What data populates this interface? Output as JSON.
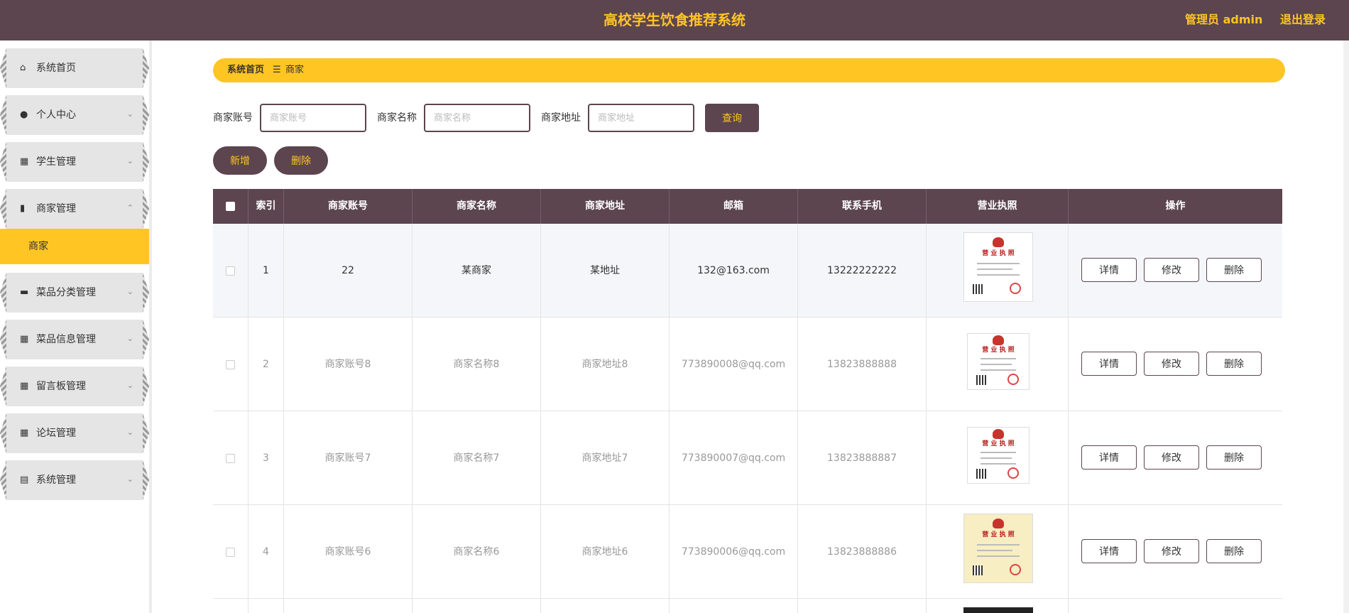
{
  "header": {
    "title": "高校学生饮食推荐系统",
    "admin": "管理员 admin",
    "logout": "退出登录"
  },
  "sidebar": {
    "items": [
      {
        "label": "系统首页",
        "icon": "home-icon",
        "glyph": "⌂",
        "arrow": ""
      },
      {
        "label": "个人中心",
        "icon": "user-icon",
        "glyph": "●",
        "arrow": "⌄"
      },
      {
        "label": "学生管理",
        "icon": "grid-icon",
        "glyph": "▦",
        "arrow": "⌄"
      },
      {
        "label": "商家管理",
        "icon": "bar-chart-icon",
        "glyph": "▮",
        "arrow": "⌃"
      },
      {
        "label": "菜品分类管理",
        "icon": "briefcase-icon",
        "glyph": "▬",
        "arrow": "⌄"
      },
      {
        "label": "菜品信息管理",
        "icon": "grid-icon",
        "glyph": "▦",
        "arrow": "⌄"
      },
      {
        "label": "留言板管理",
        "icon": "grid-icon",
        "glyph": "▦",
        "arrow": "⌄"
      },
      {
        "label": "论坛管理",
        "icon": "grid-icon",
        "glyph": "▦",
        "arrow": "⌄"
      },
      {
        "label": "系统管理",
        "icon": "clipboard-icon",
        "glyph": "▤",
        "arrow": "⌄"
      }
    ],
    "sub_item": "商家"
  },
  "breadcrumb": {
    "home": "系统首页",
    "sep": "☰",
    "current": "商家"
  },
  "search": {
    "account_label": "商家账号",
    "account_placeholder": "商家账号",
    "name_label": "商家名称",
    "name_placeholder": "商家名称",
    "address_label": "商家地址",
    "address_placeholder": "商家地址",
    "query": "查询"
  },
  "actions": {
    "add": "新增",
    "delete": "删除"
  },
  "table": {
    "headers": [
      "索引",
      "商家账号",
      "商家名称",
      "商家地址",
      "邮箱",
      "联系手机",
      "营业执照",
      "操作"
    ],
    "license_title": "营 业 执 照",
    "ops": {
      "detail": "详情",
      "edit": "修改",
      "delete": "删除"
    },
    "rows": [
      {
        "index": "1",
        "account": "22",
        "name": "某商家",
        "address": "某地址",
        "email": "132@163.com",
        "phone": "13222222222"
      },
      {
        "index": "2",
        "account": "商家账号8",
        "name": "商家名称8",
        "address": "商家地址8",
        "email": "773890008@qq.com",
        "phone": "13823888888"
      },
      {
        "index": "3",
        "account": "商家账号7",
        "name": "商家名称7",
        "address": "商家地址7",
        "email": "773890007@qq.com",
        "phone": "13823888887"
      },
      {
        "index": "4",
        "account": "商家账号6",
        "name": "商家名称6",
        "address": "商家地址6",
        "email": "773890006@qq.com",
        "phone": "13823888886"
      }
    ]
  }
}
